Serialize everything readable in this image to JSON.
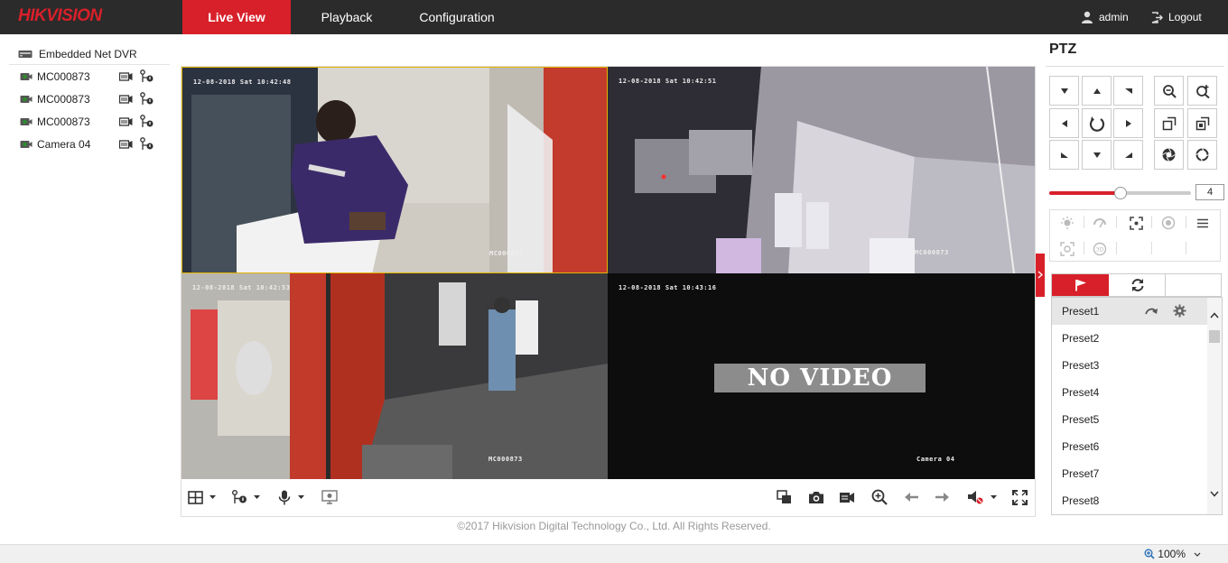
{
  "header": {
    "logo": "HIKVISION",
    "nav": [
      {
        "label": "Live View",
        "active": true
      },
      {
        "label": "Playback",
        "active": false
      },
      {
        "label": "Configuration",
        "active": false
      }
    ],
    "user": "admin",
    "logout": "Logout"
  },
  "tree": {
    "root": "Embedded Net DVR",
    "cameras": [
      "MC000873",
      "MC000873",
      "MC000873",
      "Camera 04"
    ]
  },
  "views": [
    {
      "timestamp": "12-08-2018 Sat 10:42:48",
      "label": "MC000873"
    },
    {
      "timestamp": "12-08-2018 Sat 10:42:51",
      "label": "MC000873"
    },
    {
      "timestamp": "12-08-2018 Sat 10:42:53",
      "label": "MC000873"
    },
    {
      "timestamp": "12-08-2018 Sat 10:43:16",
      "label": "Camera 04",
      "no_video": "NO VIDEO"
    }
  ],
  "footer": "©2017 Hikvision Digital Technology Co., Ltd. All Rights Reserved.",
  "zoom": "100%",
  "ptz": {
    "title": "PTZ",
    "speed": "4",
    "speed_fraction": 0.5,
    "presets": [
      "Preset1",
      "Preset2",
      "Preset3",
      "Preset4",
      "Preset5",
      "Preset6",
      "Preset7",
      "Preset8"
    ]
  },
  "colors": {
    "accent": "#d8202a",
    "topbar": "#2b2b2b",
    "selected_border": "#e5b400"
  }
}
